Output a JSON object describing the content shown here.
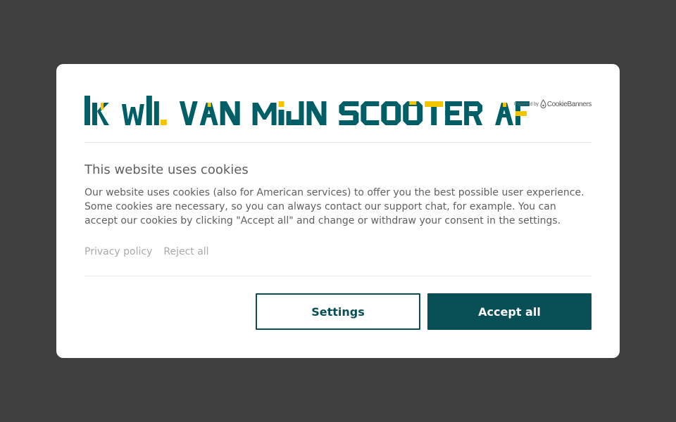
{
  "colors": {
    "overlay": "#3f3f3f",
    "brand_teal": "#005f66",
    "brand_yellow": "#f2c500",
    "button_teal": "#094f56",
    "text": "#5f5f5f",
    "link": "#a9a9a9"
  },
  "logo": {
    "text": "IK WIL VAN MIJN SCOOTER AF"
  },
  "powered_by": {
    "label": "Powered by",
    "brand": "CookieBanners",
    "icon": "cookie-drop-icon"
  },
  "banner": {
    "title": "This website uses cookies",
    "body": "Our website uses cookies (also for American services) to offer you the best possible user experience. Some cookies are necessary, so you can always contact our support chat, for example. You can accept our cookies by clicking \"Accept all\" and change or withdraw your consent in the settings."
  },
  "links": {
    "privacy_policy": "Privacy policy",
    "reject_all": "Reject all"
  },
  "buttons": {
    "settings": "Settings",
    "accept_all": "Accept all"
  }
}
